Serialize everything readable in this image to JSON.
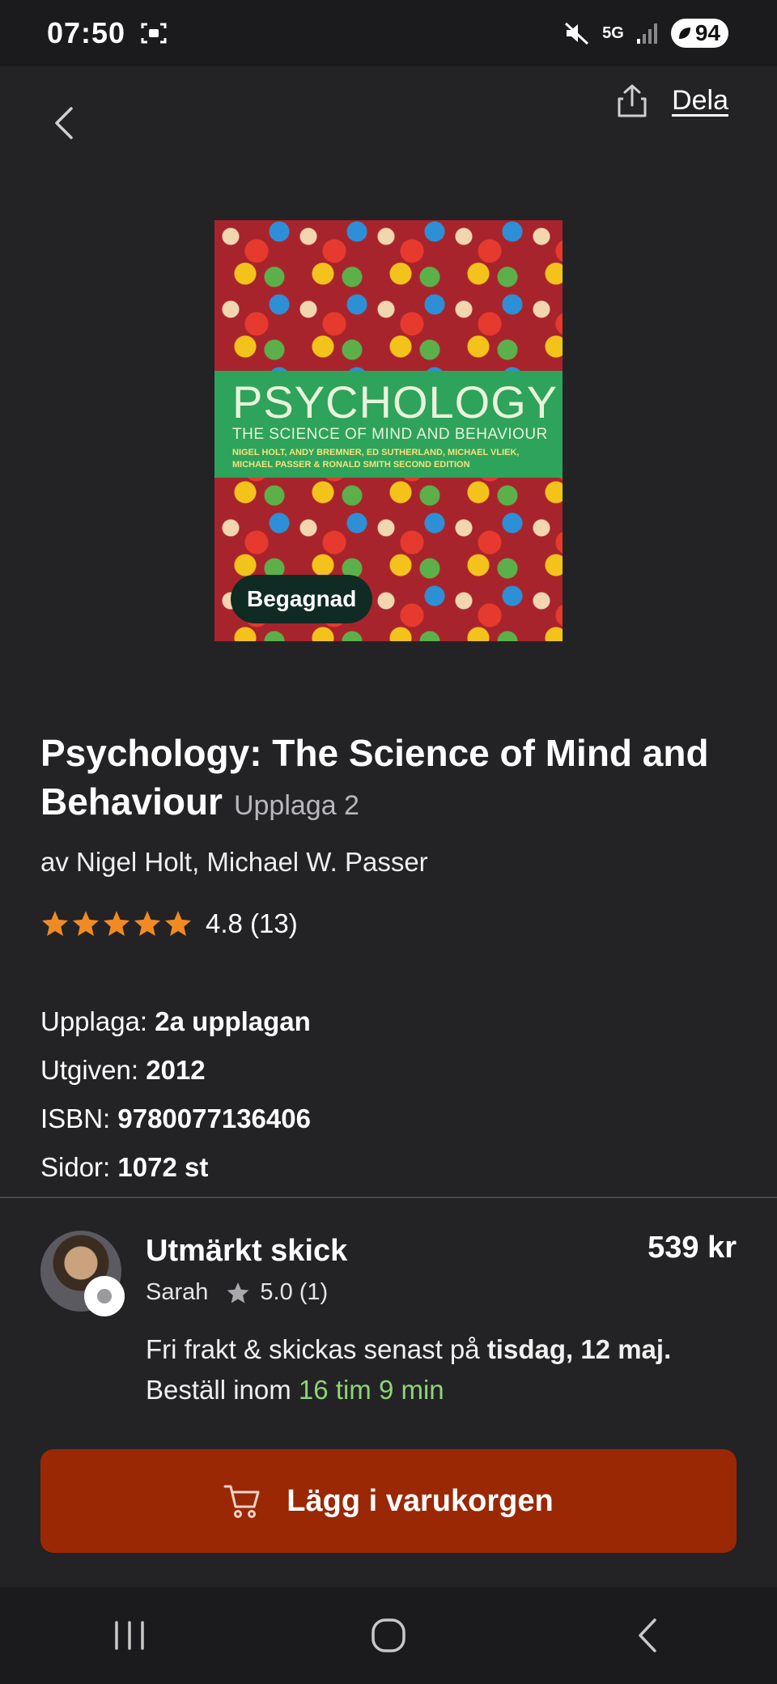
{
  "status_bar": {
    "time": "07:50",
    "network": "5G",
    "battery": "94"
  },
  "header": {
    "share_label": "Dela"
  },
  "cover": {
    "title": "PSYCHOLOGY",
    "subtitle": "THE SCIENCE OF MIND AND BEHAVIOUR",
    "authors_line": "NIGEL HOLT, ANDY BREMNER, ED SUTHERLAND, MICHAEL VLIEK, MICHAEL PASSER & RONALD SMITH  SECOND EDITION",
    "badge": "Begagnad"
  },
  "book": {
    "title": "Psychology: The Science of Mind and Behaviour",
    "edition_inline": "Upplaga 2",
    "authors": "av Nigel Holt, Michael W. Passer",
    "rating_text": "4.8 (13)",
    "stars": 5,
    "details": [
      {
        "label": "Upplaga:",
        "value": "2a upplagan"
      },
      {
        "label": "Utgiven:",
        "value": "2012"
      },
      {
        "label": "ISBN:",
        "value": "9780077136406"
      },
      {
        "label": "Sidor:",
        "value": "1072 st"
      }
    ]
  },
  "offer": {
    "condition": "Utmärkt skick",
    "price": "539 kr",
    "seller": "Sarah",
    "seller_rating": "5.0 (1)",
    "shipping_prefix": "Fri frakt & skickas senast på ",
    "shipping_date": "tisdag, 12 maj.",
    "order_prefix": "Beställ inom ",
    "order_countdown": "16 tim 9 min"
  },
  "actions": {
    "add_to_cart": "Lägg i varukorgen"
  },
  "colors": {
    "background": "#232325",
    "cta": "#9a2805",
    "star": "#f08a24",
    "countdown": "#8fd37a"
  }
}
